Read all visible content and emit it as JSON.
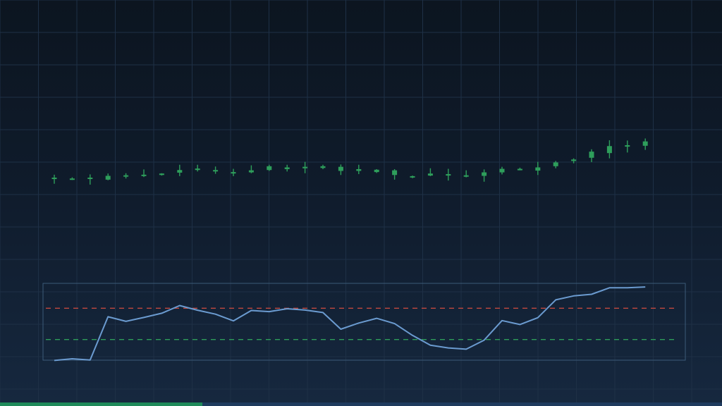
{
  "colors": {
    "up": "#2e9e5b",
    "down": "#d2493c",
    "oscillator": "#6b9bd0",
    "overbought": "#c2483f",
    "oversold": "#2e9e5b",
    "grid": "#1e3046",
    "panel_border": "#3b5a78",
    "progress": "#1f8a5a"
  },
  "progress": {
    "fraction": 0.28
  },
  "chart_data": [
    {
      "type": "candlestick",
      "grid": true,
      "ylim": [
        0,
        100
      ],
      "x": [
        1,
        2,
        3,
        4,
        5,
        6,
        7,
        8,
        9,
        10,
        11,
        12,
        13,
        14,
        15,
        16,
        17,
        18,
        19,
        20,
        21,
        22,
        23,
        24,
        25,
        26,
        27,
        28,
        29,
        30,
        31,
        32,
        33,
        34,
        35
      ],
      "candles": [
        {
          "open": 50.4,
          "close": 50.9,
          "high": 51.9,
          "low": 48.8
        },
        {
          "open": 50.2,
          "close": 50.6,
          "high": 51.0,
          "low": 50.1
        },
        {
          "open": 50.5,
          "close": 50.9,
          "high": 52.0,
          "low": 48.5
        },
        {
          "open": 50.2,
          "close": 51.5,
          "high": 52.3,
          "low": 50.0
        },
        {
          "open": 51.3,
          "close": 51.7,
          "high": 52.4,
          "low": 50.6
        },
        {
          "open": 51.5,
          "close": 51.9,
          "high": 53.7,
          "low": 51.1
        },
        {
          "open": 51.8,
          "close": 52.3,
          "high": 52.4,
          "low": 51.6
        },
        {
          "open": 52.6,
          "close": 53.5,
          "high": 55.3,
          "low": 51.4
        },
        {
          "open": 53.5,
          "close": 54.0,
          "high": 55.3,
          "low": 53.0
        },
        {
          "open": 53.0,
          "close": 53.5,
          "high": 54.7,
          "low": 52.2
        },
        {
          "open": 52.3,
          "close": 52.8,
          "high": 53.9,
          "low": 51.4
        },
        {
          "open": 52.7,
          "close": 53.4,
          "high": 55.1,
          "low": 52.4
        },
        {
          "open": 53.5,
          "close": 54.8,
          "high": 55.3,
          "low": 53.2
        },
        {
          "open": 53.8,
          "close": 54.4,
          "high": 55.3,
          "low": 53.0
        },
        {
          "open": 54.1,
          "close": 54.6,
          "high": 56.3,
          "low": 52.4
        },
        {
          "open": 54.2,
          "close": 54.8,
          "high": 55.3,
          "low": 53.8
        },
        {
          "open": 53.2,
          "close": 54.6,
          "high": 55.4,
          "low": 51.8
        },
        {
          "open": 53.2,
          "close": 53.8,
          "high": 55.3,
          "low": 52.1
        },
        {
          "open": 52.8,
          "close": 53.6,
          "high": 53.8,
          "low": 52.5
        },
        {
          "open": 51.8,
          "close": 53.4,
          "high": 53.8,
          "low": 50.2
        },
        {
          "open": 51.0,
          "close": 51.4,
          "high": 51.6,
          "low": 50.7
        },
        {
          "open": 51.6,
          "close": 52.3,
          "high": 54.1,
          "low": 51.4
        },
        {
          "open": 51.6,
          "close": 52.1,
          "high": 53.9,
          "low": 49.9
        },
        {
          "open": 51.2,
          "close": 51.7,
          "high": 53.4,
          "low": 51.0
        },
        {
          "open": 51.5,
          "close": 52.7,
          "high": 53.7,
          "low": 49.5
        },
        {
          "open": 52.7,
          "close": 53.9,
          "high": 54.6,
          "low": 52.0
        },
        {
          "open": 53.6,
          "close": 53.9,
          "high": 54.3,
          "low": 53.4
        },
        {
          "open": 53.3,
          "close": 54.4,
          "high": 56.3,
          "low": 51.8
        },
        {
          "open": 54.8,
          "close": 56.1,
          "high": 56.6,
          "low": 54.1
        },
        {
          "open": 56.6,
          "close": 57.1,
          "high": 57.5,
          "low": 55.8
        },
        {
          "open": 57.7,
          "close": 59.8,
          "high": 60.6,
          "low": 56.2
        },
        {
          "open": 59.3,
          "close": 61.7,
          "high": 63.7,
          "low": 57.5
        },
        {
          "open": 61.5,
          "close": 62.0,
          "high": 63.6,
          "low": 59.5
        },
        {
          "open": 61.8,
          "close": 63.3,
          "high": 64.3,
          "low": 60.4
        }
      ]
    },
    {
      "type": "line",
      "grid": false,
      "ylim": [
        0,
        100
      ],
      "x": [
        1,
        2,
        3,
        4,
        5,
        6,
        7,
        8,
        9,
        10,
        11,
        12,
        13,
        14,
        15,
        16,
        17,
        18,
        19,
        20,
        21,
        22,
        23,
        24,
        25,
        26,
        27,
        28,
        29,
        30,
        31,
        32,
        33,
        34,
        35
      ],
      "values": [
        3.2,
        5.4,
        3.8,
        59.1,
        53.2,
        58.2,
        63.6,
        73.4,
        67.5,
        62.4,
        53.9,
        67.1,
        65.7,
        69.4,
        67.7,
        64.5,
        43.2,
        51.1,
        57.1,
        50.4,
        35.3,
        22.7,
        19.3,
        17.7,
        29.2,
        54.2,
        49.2,
        57.9,
        80.7,
        85.8,
        87.8,
        96.1,
        96.2,
        97.2
      ],
      "thresholds": [
        70,
        30
      ],
      "panel_frame": true
    }
  ]
}
